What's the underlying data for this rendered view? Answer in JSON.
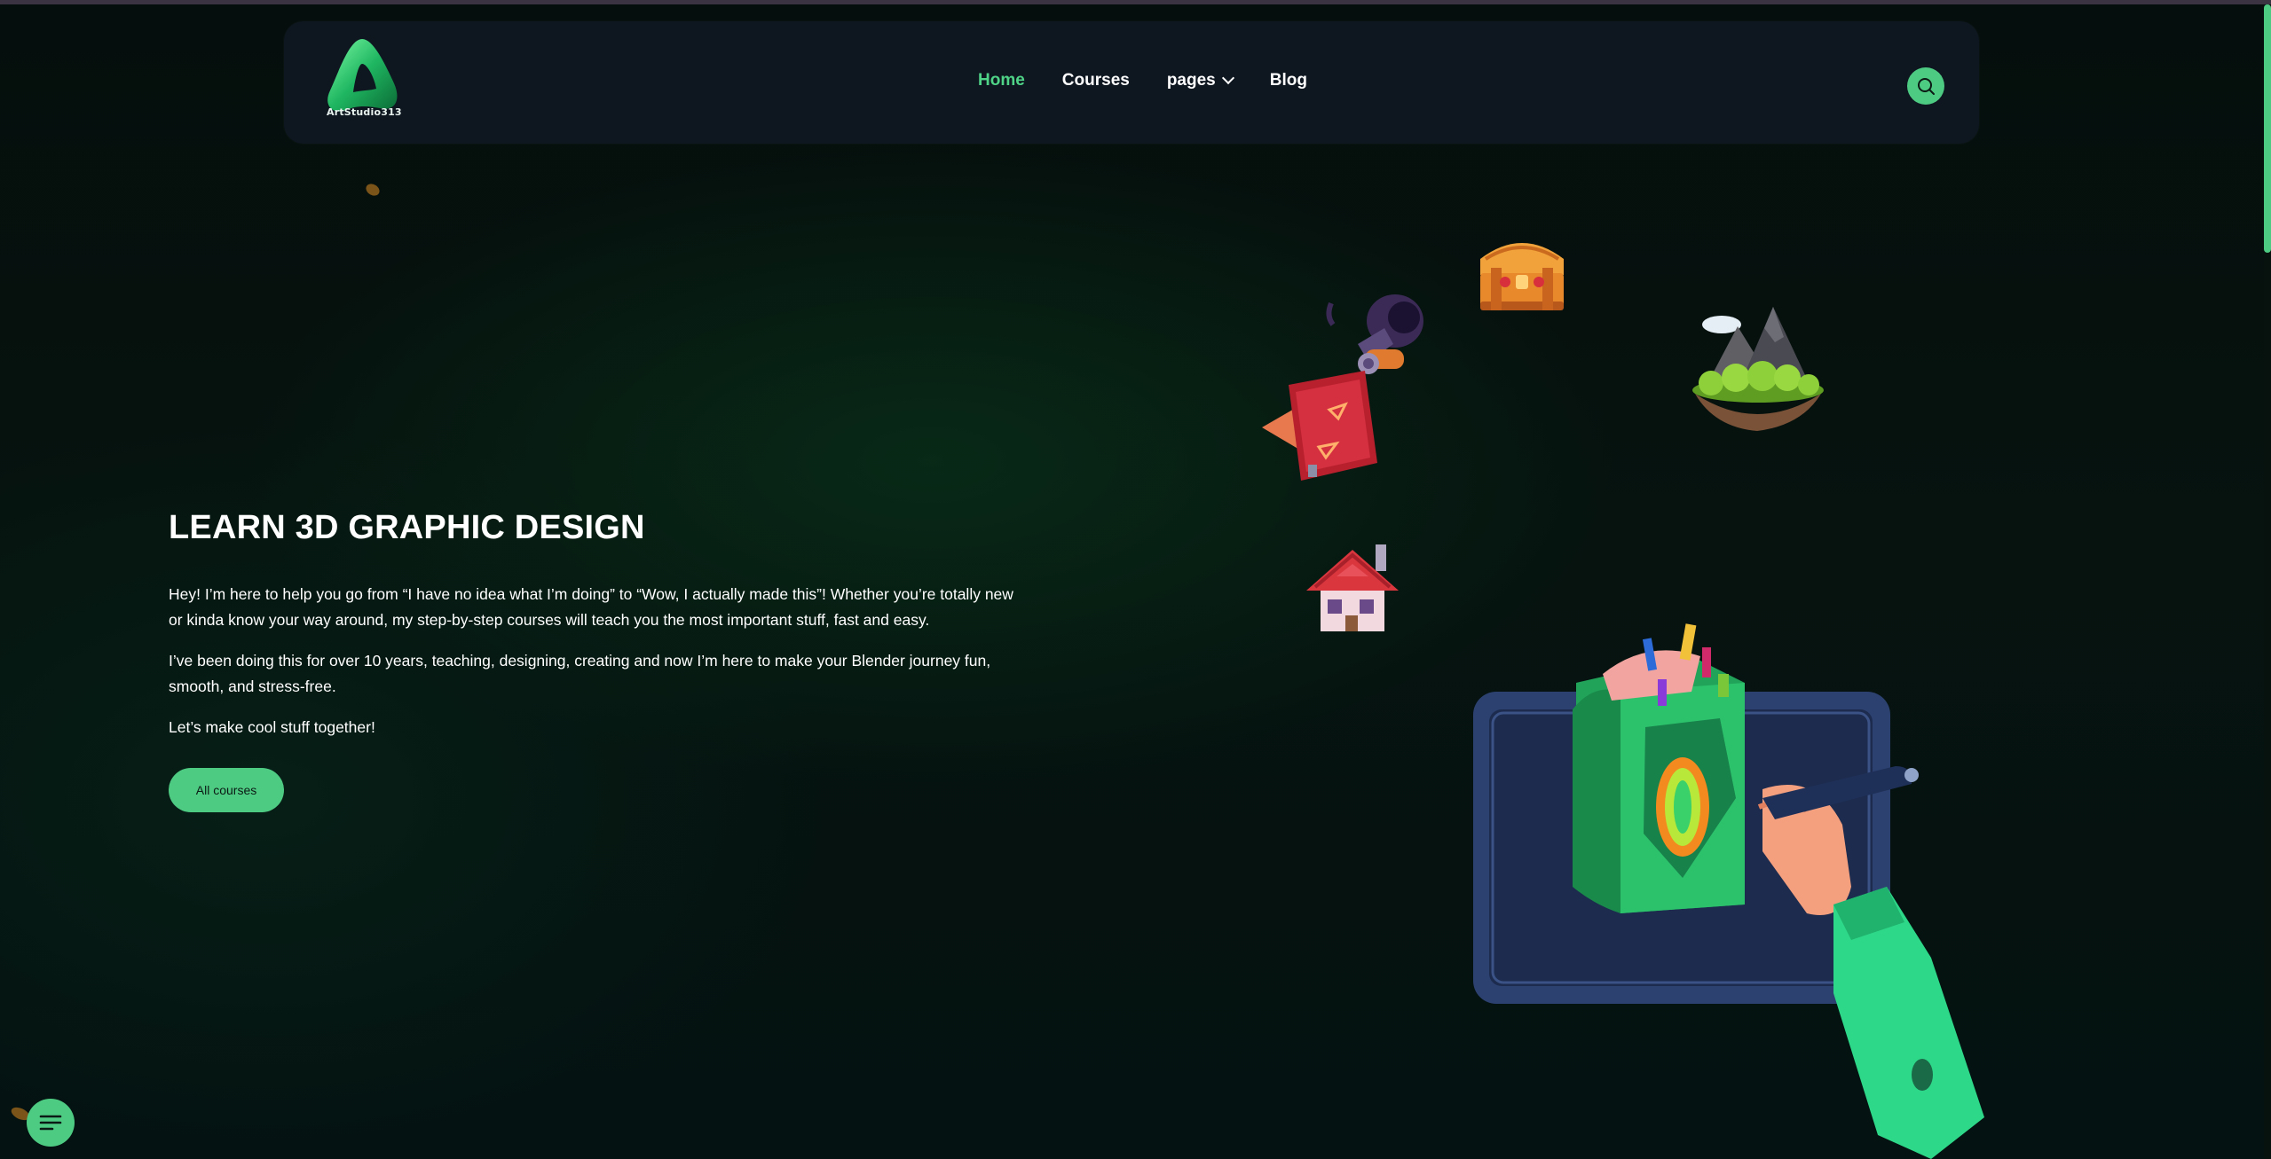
{
  "header": {
    "logo_text": "ArtStudio313",
    "nav": [
      {
        "label": "Home",
        "active": true
      },
      {
        "label": "Courses",
        "active": false
      },
      {
        "label": "pages",
        "active": false,
        "has_dropdown": true
      },
      {
        "label": "Blog",
        "active": false
      }
    ],
    "search_icon": "search-icon"
  },
  "hero": {
    "title": "LEARN 3D GRAPHIC DESIGN",
    "paragraph_1": "Hey! I’m here to help you go from “I have no idea what I’m doing” to “Wow, I actually made this”! Whether you’re totally new or kinda know your way around, my step-by-step courses will teach you the most important stuff, fast and easy.",
    "paragraph_2": "I’ve been doing this for over 10 years, teaching, designing, creating and now I’m here to make your Blender journey fun, smooth, and stress-free.",
    "paragraph_3": "Let’s make cool stuff together!",
    "cta_label": "All courses"
  },
  "floating": {
    "chat_icon": "menu-lines-icon"
  },
  "colors": {
    "accent": "#4ecb83",
    "header_bg": "#0e1620",
    "page_bg": "#05100c"
  }
}
